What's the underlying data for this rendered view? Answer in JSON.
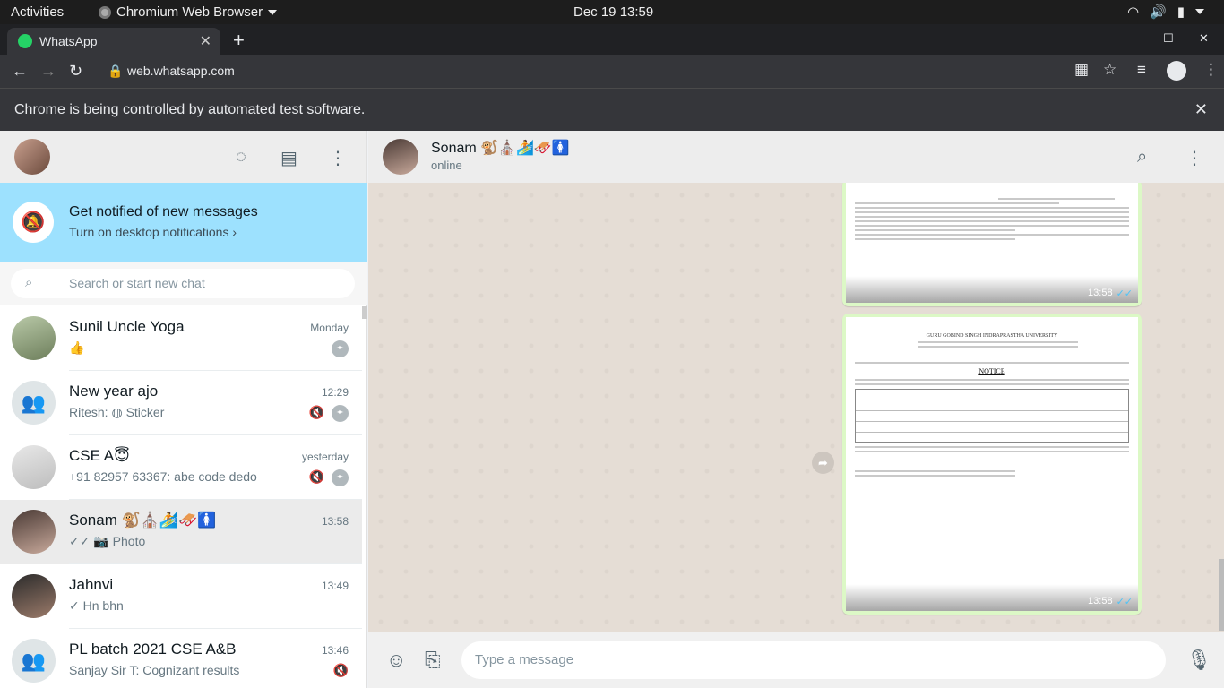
{
  "system": {
    "activities": "Activities",
    "app_name": "Chromium Web Browser",
    "clock": "Dec 19  13:59"
  },
  "browser": {
    "tab_title": "WhatsApp",
    "url": "web.whatsapp.com",
    "infobar_text": "Chrome is being controlled by automated test software."
  },
  "sidebar": {
    "notify_title": "Get notified of new messages",
    "notify_subtitle": "Turn on desktop notifications ›",
    "search_placeholder": "Search or start new chat",
    "chats": [
      {
        "name": "Sunil Uncle Yoga",
        "time": "Monday",
        "last": "👍"
      },
      {
        "name": "New year ajo",
        "time": "12:29",
        "last": "Ritesh: ◍ Sticker"
      },
      {
        "name": "CSE A😇",
        "time": "yesterday",
        "last": "+91 82957 63367: abe code dedo"
      },
      {
        "name": "Sonam 🐒⛪🏄🛷🚺",
        "time": "13:58",
        "last": "✓✓ 📷 Photo"
      },
      {
        "name": "Jahnvi",
        "time": "13:49",
        "last": "✓ Hn bhn"
      },
      {
        "name": "PL batch 2021 CSE A&B",
        "time": "13:46",
        "last": "Sanjay Sir T: Cognizant results"
      }
    ]
  },
  "conversation": {
    "name": "Sonam 🐒⛪🏄🛷🚺",
    "status": "online",
    "messages": [
      {
        "time": "13:58",
        "ticks": "✓✓"
      },
      {
        "time": "13:58",
        "ticks": "✓✓",
        "doc_header": "GURU GOBIND SINGH INDRAPRASTHA UNIVERSITY",
        "doc_notice": "NOTICE"
      }
    ],
    "composer_placeholder": "Type a message"
  },
  "colors": {
    "notify_banner": "#9de1fe",
    "bubble_out": "#dcf8c6",
    "chat_bg": "#e5ddd5"
  }
}
